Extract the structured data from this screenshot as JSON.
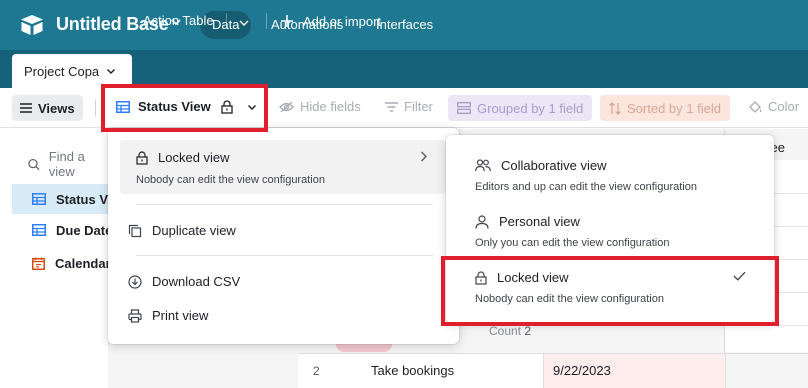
{
  "colors": {
    "topbar": "#1e7891",
    "tabbar": "#16627a",
    "sidebar_selected": "#d8ebf7",
    "annotation_red": "#e01f2e",
    "group_chip": "#ebe7f7",
    "sort_chip": "#fbe5dc"
  },
  "header": {
    "base_title": "Untitled Base",
    "nav": [
      "Data",
      "Automations",
      "Interfaces"
    ]
  },
  "tabs": {
    "active": "Project Copa",
    "second": "Action Table",
    "add_label": "Add or import"
  },
  "toolbar": {
    "views_label": "Views",
    "current_view": "Status View",
    "hide_fields": "Hide fields",
    "filter": "Filter",
    "grouped": "Grouped by 1 field",
    "sorted": "Sorted by 1 field",
    "color": "Color"
  },
  "sidebar": {
    "search_placeholder": "Find a view",
    "items": [
      {
        "label": "Status View",
        "icon": "grid-icon"
      },
      {
        "label": "Due Date",
        "icon": "grid-icon"
      },
      {
        "label": "Calendar",
        "icon": "calendar-icon"
      }
    ]
  },
  "view_menu": {
    "locked_title": "Locked view",
    "locked_desc": "Nobody can edit the view configuration",
    "duplicate": "Duplicate view",
    "download_csv": "Download CSV",
    "print": "Print view"
  },
  "permission_menu": {
    "options": [
      {
        "title": "Collaborative view",
        "desc": "Editors and up can edit the view configuration",
        "icon": "users-icon"
      },
      {
        "title": "Personal view",
        "desc": "Only you can edit the view configuration",
        "icon": "person-icon"
      },
      {
        "title": "Locked view",
        "desc": "Nobody can edit the view configuration",
        "icon": "lock-icon",
        "selected": true
      }
    ]
  },
  "grid": {
    "column_header_partial": "gnee",
    "count_label": "Count",
    "count_value": "2",
    "row": {
      "number": "2",
      "name": "Take bookings",
      "date": "9/22/2023"
    }
  }
}
